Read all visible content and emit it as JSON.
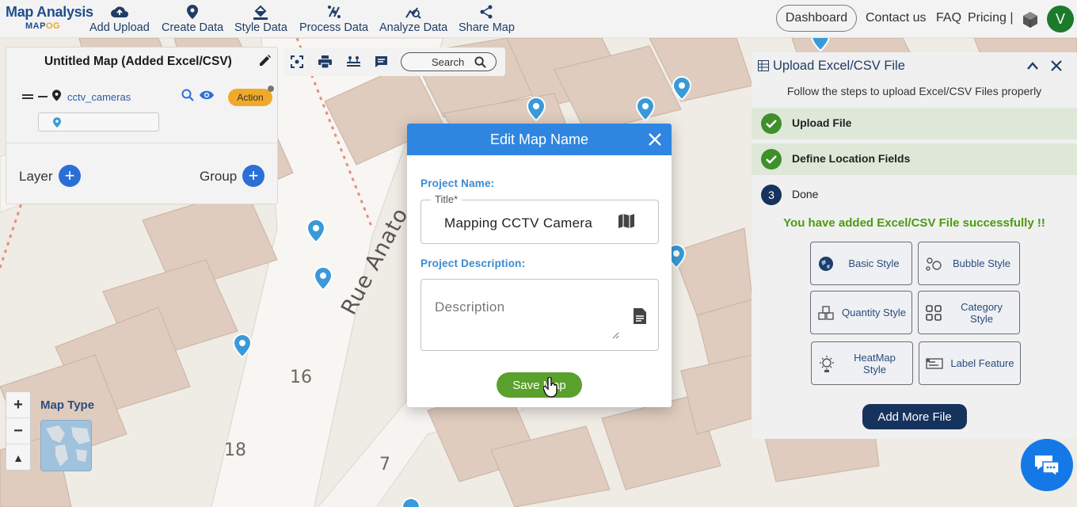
{
  "app": {
    "logo_title": "Map Analysis",
    "logo_sub_a": "MAP",
    "logo_sub_b": "OG"
  },
  "nav": {
    "items": [
      {
        "label": "Add Upload",
        "icon": "cloud-upload-icon"
      },
      {
        "label": "Create Data",
        "icon": "location-pin-icon"
      },
      {
        "label": "Style Data",
        "icon": "paint-bucket-icon"
      },
      {
        "label": "Process Data",
        "icon": "process-icon"
      },
      {
        "label": "Analyze Data",
        "icon": "analyze-icon"
      },
      {
        "label": "Share Map",
        "icon": "share-icon"
      }
    ],
    "dashboard": "Dashboard",
    "contact": "Contact us",
    "faq": "FAQ",
    "pricing": "Pricing |",
    "avatar_initial": "V"
  },
  "layer_panel": {
    "title": "Untitled Map (Added Excel/CSV)",
    "layer_name": "cctv_cameras",
    "action_label": "Action",
    "layer_label": "Layer",
    "group_label": "Group"
  },
  "toolbar": {
    "search_label": "Search"
  },
  "map": {
    "street": "Rue Anato",
    "house_numbers": [
      "16",
      "18",
      "7"
    ],
    "map_type_label": "Map Type"
  },
  "upload_panel": {
    "title": "Upload Excel/CSV File",
    "subtitle": "Follow the steps to upload Excel/CSV Files properly",
    "steps": [
      {
        "label": "Upload File",
        "status": "done"
      },
      {
        "label": "Define Location Fields",
        "status": "done"
      },
      {
        "label": "Done",
        "number": "3",
        "status": "current"
      }
    ],
    "success_message": "You have added Excel/CSV File successfully !!",
    "style_buttons": [
      {
        "label": "Basic Style",
        "icon": "globe-icon"
      },
      {
        "label": "Bubble Style",
        "icon": "bubble-icon"
      },
      {
        "label": "Quantity Style",
        "icon": "quantity-icon"
      },
      {
        "label": "Category Style",
        "icon": "category-grid-icon"
      },
      {
        "label": "HeatMap Style",
        "icon": "heatmap-icon"
      },
      {
        "label": "Label Feature",
        "icon": "label-icon"
      }
    ],
    "add_more": "Add More File"
  },
  "modal": {
    "title": "Edit Map Name",
    "project_name_label": "Project Name:",
    "title_legend": "Title*",
    "title_value": "Mapping CCTV Camera",
    "project_description_label": "Project Description:",
    "description_placeholder": "Description",
    "save_label": "Save Map"
  },
  "colors": {
    "accent_blue": "#2f86e0",
    "nav_blue": "#1f3d66",
    "success_green": "#4d9a14",
    "save_green": "#5aa02c",
    "action_orange": "#f0a92a",
    "step_done_green": "#3f8f2a",
    "step_current_navy": "#16335e"
  }
}
